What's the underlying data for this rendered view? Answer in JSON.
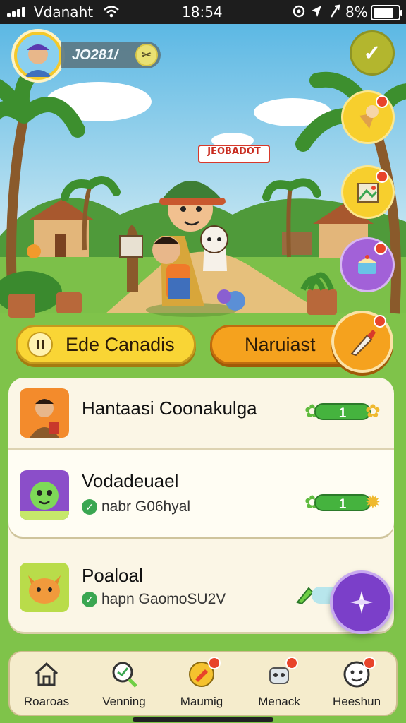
{
  "status_bar": {
    "carrier": "Vdanaht",
    "time": "18:54",
    "battery": "8%"
  },
  "header": {
    "score": "JO281/",
    "score_icon": "ticket-icon",
    "check_icon": "check-icon"
  },
  "scene": {
    "sign": "JEOBADOT"
  },
  "side_actions": [
    {
      "name": "ice-cream-cone-icon"
    },
    {
      "name": "map-icon"
    },
    {
      "name": "cake-icon"
    }
  ],
  "actions": {
    "primary_label": "Ede Canadis",
    "secondary_label": "Naruiast",
    "secondary_icon": "brush-icon"
  },
  "list": {
    "items": [
      {
        "title": "Hantaasi Coonakulga",
        "subtitle": "",
        "progress": "1"
      },
      {
        "title": "Vodadeuael",
        "subtitle": "nabr G06hyal",
        "progress": "1"
      },
      {
        "title": "Poaloal",
        "subtitle": "hapn GaomoSU2V",
        "progress": ""
      }
    ]
  },
  "fab": {
    "icon": "compass-icon",
    "color": "#7b3fc9"
  },
  "tabs": [
    {
      "label": "Roaroas",
      "icon": "home-icon"
    },
    {
      "label": "Venning",
      "icon": "search-icon"
    },
    {
      "label": "Maumig",
      "icon": "chat-icon"
    },
    {
      "label": "Menack",
      "icon": "robot-icon"
    },
    {
      "label": "Heeshun",
      "icon": "face-icon"
    }
  ],
  "colors": {
    "accent": "#f4c92b",
    "orange": "#f5a623",
    "panel": "#fbf6e6",
    "progress": "#45b33e"
  }
}
